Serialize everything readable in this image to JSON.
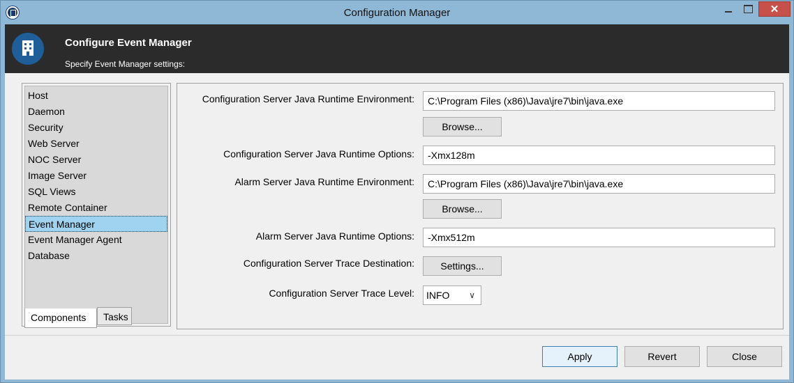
{
  "window": {
    "title": "Configuration Manager",
    "close_glyph": "✕"
  },
  "header": {
    "title": "Configure Event Manager",
    "subtitle": "Specify Event Manager settings:"
  },
  "nav": {
    "items": [
      {
        "label": "Host"
      },
      {
        "label": "Daemon"
      },
      {
        "label": "Security"
      },
      {
        "label": "Web Server"
      },
      {
        "label": "NOC Server"
      },
      {
        "label": "Image Server"
      },
      {
        "label": "SQL Views"
      },
      {
        "label": "Remote Container"
      },
      {
        "label": "Event Manager",
        "selected": true
      },
      {
        "label": "Event Manager Agent"
      },
      {
        "label": "Database"
      }
    ],
    "tabs": [
      "Components",
      "Tasks"
    ]
  },
  "form": {
    "cfg_jre_label": "Configuration Server Java Runtime Environment:",
    "cfg_jre_value": "C:\\Program Files (x86)\\Java\\jre7\\bin\\java.exe",
    "browse_label": "Browse...",
    "cfg_opts_label": "Configuration Server Java Runtime Options:",
    "cfg_opts_value": "-Xmx128m",
    "alarm_jre_label": "Alarm Server Java Runtime Environment:",
    "alarm_jre_value": "C:\\Program Files (x86)\\Java\\jre7\\bin\\java.exe",
    "alarm_opts_label": "Alarm Server Java Runtime Options:",
    "alarm_opts_value": "-Xmx512m",
    "trace_dest_label": "Configuration Server Trace Destination:",
    "settings_label": "Settings...",
    "trace_level_label": "Configuration Server Trace Level:",
    "trace_level_value": "INFO"
  },
  "footer": {
    "apply": "Apply",
    "revert": "Revert",
    "close": "Close"
  },
  "colors": {
    "accent": "#8fb7d6",
    "header_bg": "#2b2b2b",
    "selection": "#9fd3ef"
  }
}
